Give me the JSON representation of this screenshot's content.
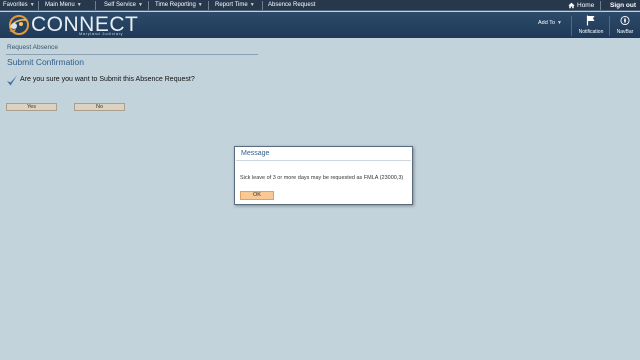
{
  "topnav": {
    "items": [
      {
        "label": "Favorites"
      },
      {
        "label": "Main Menu"
      },
      {
        "label": "Self Service"
      },
      {
        "label": "Time Reporting"
      },
      {
        "label": "Report Time"
      },
      {
        "label": "Absence Request"
      }
    ],
    "home_label": "Home",
    "signout_label": "Sign out"
  },
  "header": {
    "logo_text": "CONNECT",
    "logo_subtitle": "Maryland Judiciary",
    "add_to_label": "Add To",
    "notification_label": "Notification",
    "navbar_label": "NavBar"
  },
  "page": {
    "breadcrumb": "Request Absence",
    "title": "Submit Confirmation",
    "question": "Are you sure you want to Submit this Absence Request?",
    "yes_label": "Yes",
    "no_label": "No"
  },
  "modal": {
    "title": "Message",
    "message": "Sick leave of 3 or more days may be requested as FMLA (23000,3)",
    "ok_label": "OK"
  },
  "colors": {
    "background": "#c2d3dc",
    "topnav": "#27384c",
    "banner": "#2d4a6a",
    "title_blue": "#2f5f8d",
    "ok_button": "#f8c995"
  }
}
